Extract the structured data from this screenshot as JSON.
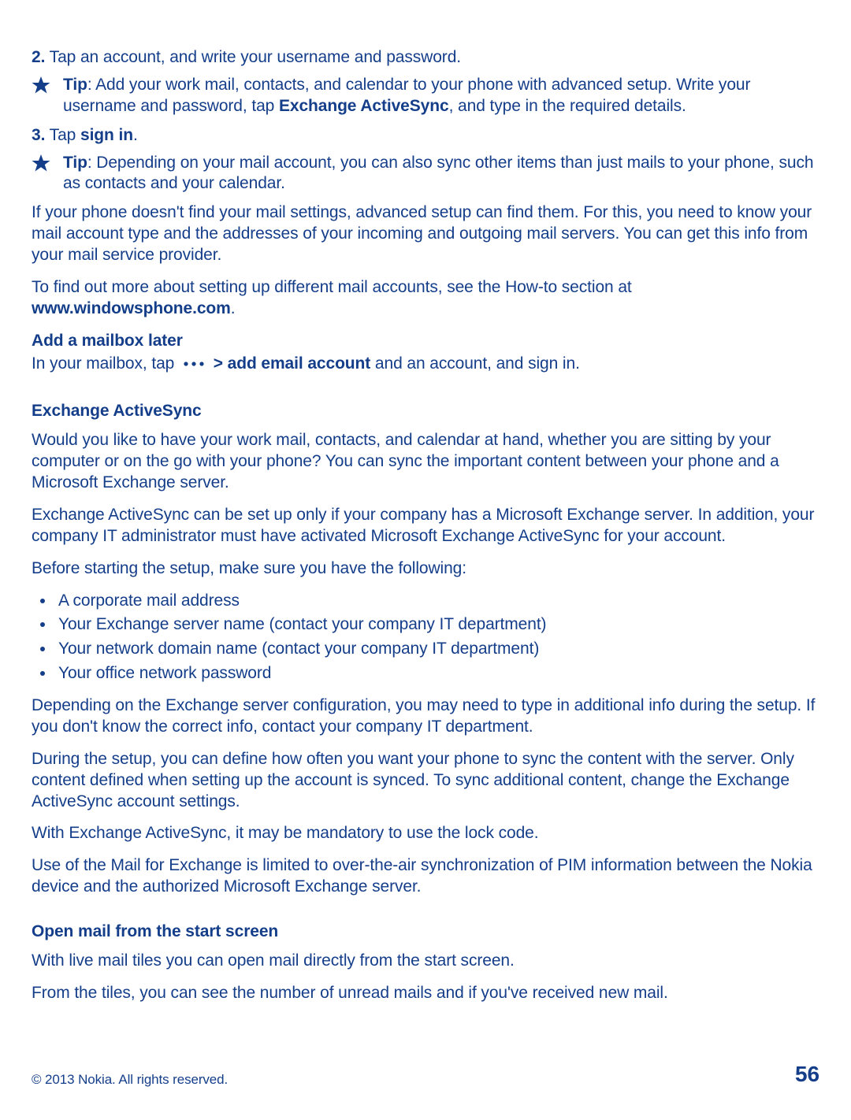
{
  "step2": {
    "num": "2.",
    "text": " Tap an account, and write your username and password."
  },
  "tip1": {
    "prefix": "Tip",
    "body": ": Add your work mail, contacts, and calendar to your phone with advanced setup. Write your username and password, tap ",
    "bold1": "Exchange ActiveSync",
    "tail": ", and type in the required details."
  },
  "step3": {
    "num": "3.",
    "a": " Tap ",
    "bold": "sign in",
    "b": "."
  },
  "tip2": {
    "prefix": "Tip",
    "body": ": Depending on your mail account, you can also sync other items than just mails to your phone, such as contacts and your calendar."
  },
  "advanced_setup_para": "If your phone doesn't find your mail settings, advanced setup can find them. For this, you need to know your mail account type and the addresses of your incoming and outgoing mail servers. You can get this info from your mail service provider.",
  "howto": {
    "a": "To find out more about setting up different mail accounts, see the How-to section at ",
    "link": "www.windowsphone.com",
    "b": "."
  },
  "add_mailbox": {
    "heading": "Add a mailbox later",
    "a": "In your mailbox, tap ",
    "gt": " > ",
    "bold": "add email account",
    "b": " and an account, and sign in."
  },
  "exchange": {
    "heading": "Exchange ActiveSync",
    "p1": "Would you like to have your work mail, contacts, and calendar at hand, whether you are sitting by your computer or on the go with your phone? You can sync the important content between your phone and a Microsoft Exchange server.",
    "p2": "Exchange ActiveSync can be set up only if your company has a Microsoft Exchange server. In addition, your company IT administrator must have activated Microsoft Exchange ActiveSync for your account.",
    "p3": "Before starting the setup, make sure you have the following:",
    "reqs": [
      "A corporate mail address",
      "Your Exchange server name (contact your company IT department)",
      "Your network domain name (contact your company IT department)",
      "Your office network password"
    ],
    "p4": "Depending on the Exchange server configuration, you may need to type in additional info during the setup. If you don't know the correct info, contact your company IT department.",
    "p5": "During the setup, you can define how often you want your phone to sync the content with the server. Only content defined when setting up the account is synced. To sync additional content, change the Exchange ActiveSync account settings.",
    "p6": "With Exchange ActiveSync, it may be mandatory to use the lock code.",
    "p7": "Use of the Mail for Exchange is limited to over-the-air synchronization of PIM information between the Nokia device and the authorized Microsoft Exchange server."
  },
  "open_mail": {
    "heading": "Open mail from the start screen",
    "p1": "With live mail tiles you can open mail directly from the start screen.",
    "p2": "From the tiles, you can see the number of unread mails and if you've received new mail."
  },
  "footer": {
    "copyright": "© 2013 Nokia. All rights reserved.",
    "page": "56"
  }
}
